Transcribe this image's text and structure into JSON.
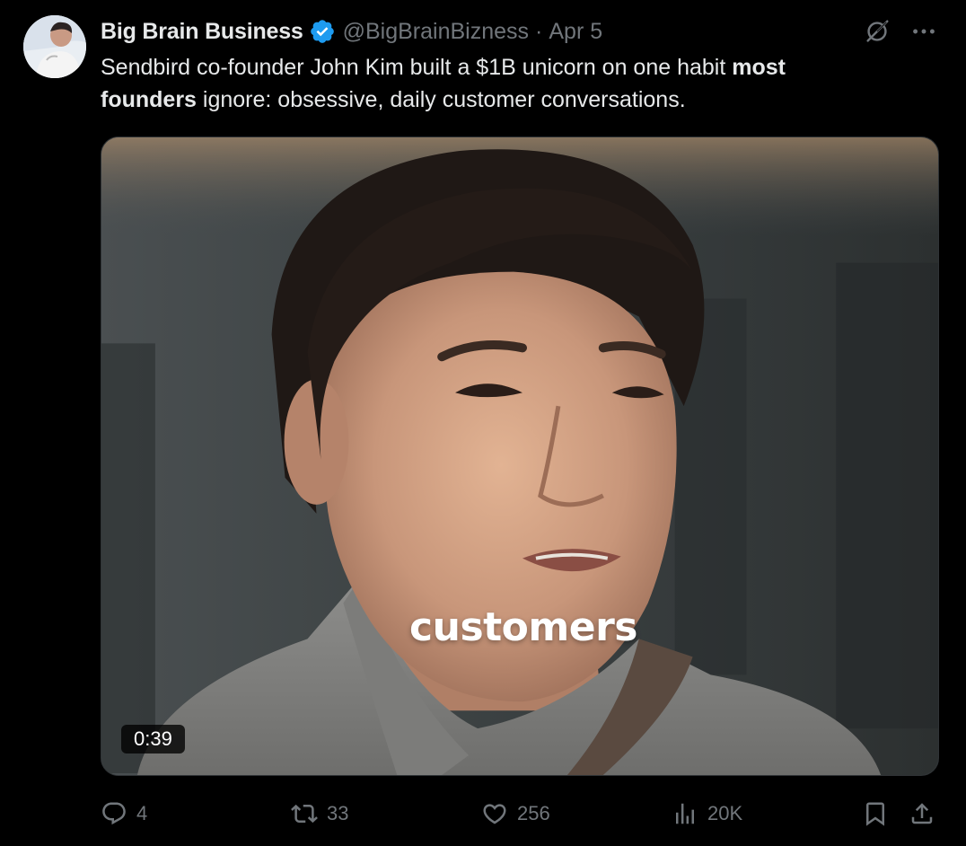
{
  "author": {
    "display_name": "Big Brain Business",
    "handle": "@BigBrainBizness",
    "separator": "·",
    "date": "Apr 5"
  },
  "tweet": {
    "text_part1": "Sendbird co-founder John Kim built a $1B unicorn on one habit ",
    "text_bold1": "most",
    "text_bold2": "founders",
    "text_part2": " ignore: obsessive, daily customer conversations."
  },
  "media": {
    "caption": "customers",
    "duration": "0:39"
  },
  "actions": {
    "replies": "4",
    "reposts": "33",
    "likes": "256",
    "views": "20K"
  },
  "icons": {
    "verified": "verified-badge-icon",
    "grok": "grok-icon",
    "more": "more-icon",
    "reply": "reply-icon",
    "repost": "repost-icon",
    "like": "heart-icon",
    "views": "views-icon",
    "bookmark": "bookmark-icon",
    "share": "share-icon"
  },
  "colors": {
    "background": "#000000",
    "text": "#e7e9ea",
    "muted": "#71767b",
    "verified": "#1d9bf0"
  }
}
